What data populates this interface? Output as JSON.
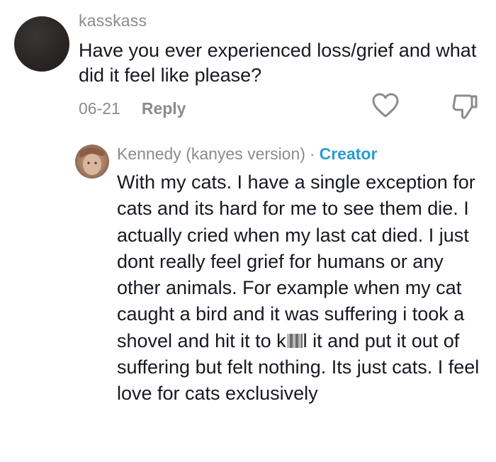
{
  "comment": {
    "username": "kasskass",
    "text": "Have you ever experienced loss/grief and what did it feel like please?",
    "date": "06-21",
    "reply_label": "Reply",
    "like_icon": "heart-outline-icon",
    "dislike_icon": "thumbs-down-icon"
  },
  "reply": {
    "username": "Kennedy (kanyes version)",
    "separator": "·",
    "badge": "Creator",
    "text_before_censor": "With my cats. I have a single exception for cats and its hard for me to see them die. I actually cried when my last cat died. I just dont really feel grief for humans or any other animals. For example when my cat caught a bird and it was suffering i took a shovel and hit it to k",
    "text_after_censor": "l it and put it out of suffering but felt nothing. Its just cats. I feel love for cats exclusively"
  },
  "colors": {
    "text": "#161823",
    "muted": "#8a8b91",
    "creator": "#2a9bcf",
    "background": "#ffffff"
  }
}
